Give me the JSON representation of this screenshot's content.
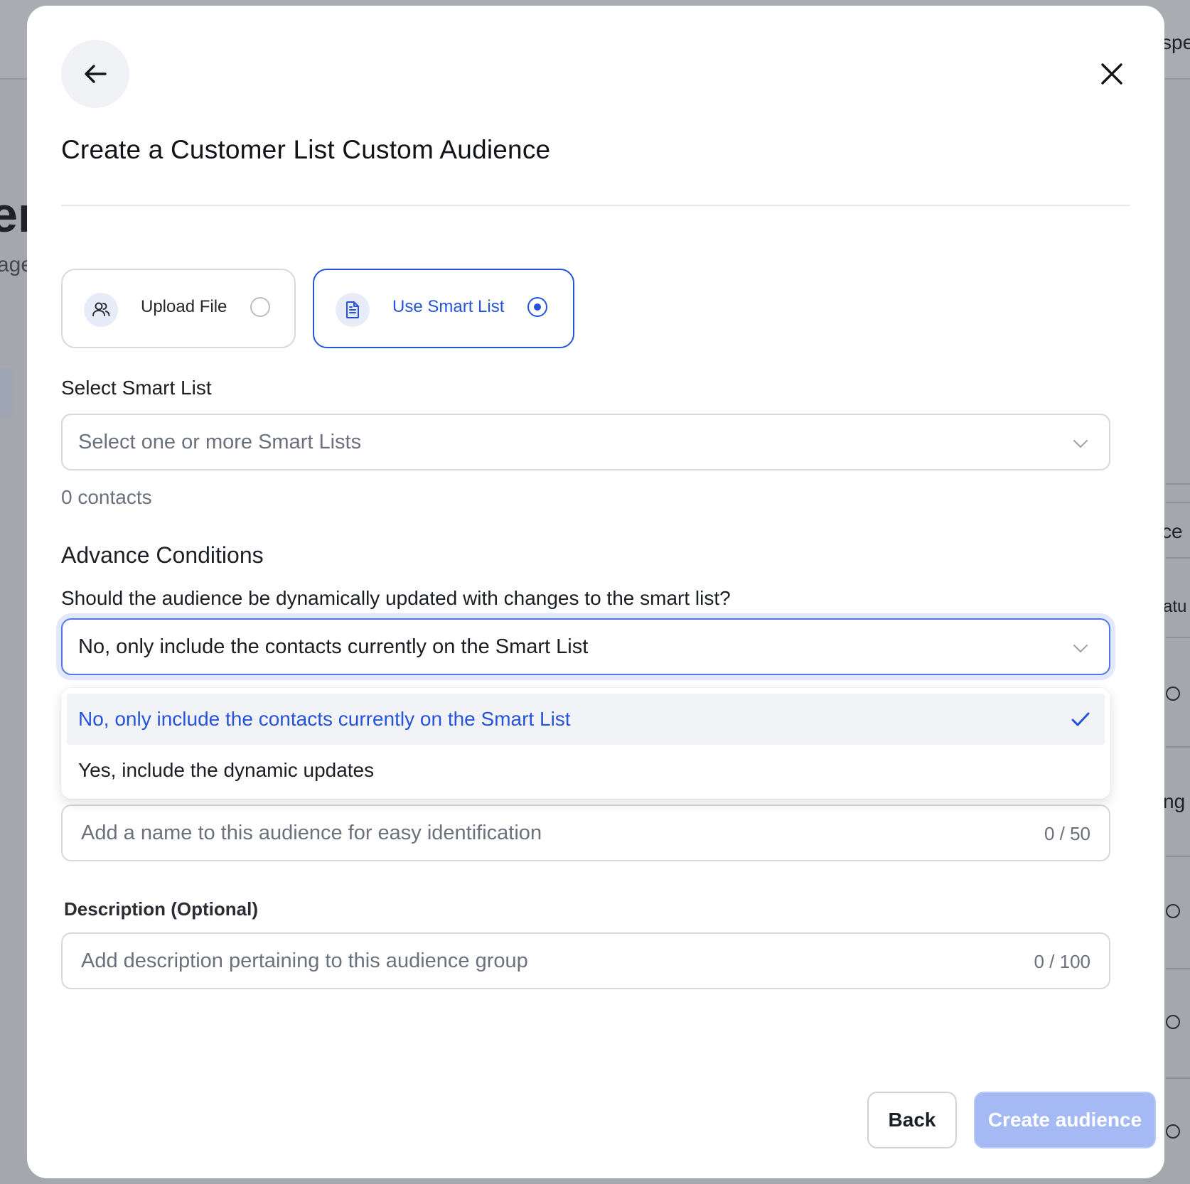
{
  "background": {
    "fragment_top_right": "spe",
    "fragment_heading": "er",
    "fragment_sub": "age",
    "fragment_ce": "ce",
    "fragment_atu": "atu",
    "fragment_ng": "ng"
  },
  "modal": {
    "title": "Create a Customer List Custom Audience",
    "back_icon": "arrow-left-icon",
    "close_icon": "close-icon",
    "modes": [
      {
        "label": "Upload File",
        "icon": "users-icon",
        "selected": false
      },
      {
        "label": "Use Smart List",
        "icon": "document-icon",
        "selected": true
      }
    ],
    "smart_list": {
      "label": "Select Smart List",
      "placeholder": "Select one or more Smart Lists",
      "count_text": "0 contacts"
    },
    "advance": {
      "title": "Advance Conditions",
      "question": "Should the audience be dynamically updated with changes to the smart list?",
      "selected_value": "No, only include the contacts currently on the Smart List",
      "options": [
        "No, only include the contacts currently on the Smart List",
        "Yes, include the dynamic updates"
      ]
    },
    "name_field": {
      "placeholder": "Add a name to this audience for easy identification",
      "counter": "0 / 50"
    },
    "description": {
      "label": "Description (Optional)",
      "placeholder": "Add description pertaining to this audience group",
      "counter": "0 / 100"
    },
    "buttons": {
      "back": "Back",
      "create": "Create audience"
    },
    "colors": {
      "accent": "#2554d8",
      "create_disabled": "#a5b9f4"
    }
  }
}
